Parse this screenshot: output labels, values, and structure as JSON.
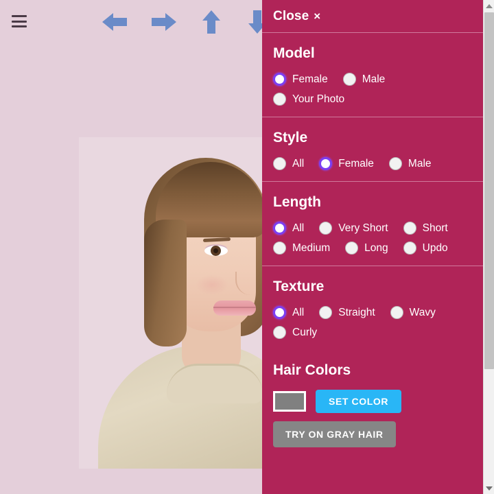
{
  "toolbar": {
    "menu_icon": "hamburger-menu-icon",
    "arrows": [
      {
        "name": "previous-arrow",
        "icon": "arrow-left-icon",
        "color": "#6a8bc8"
      },
      {
        "name": "next-arrow",
        "icon": "arrow-right-icon",
        "color": "#6a8bc8"
      },
      {
        "name": "up-arrow",
        "icon": "arrow-up-icon",
        "color": "#6a8bc8"
      },
      {
        "name": "down-arrow",
        "icon": "arrow-down-icon",
        "color": "#6a8bc8"
      }
    ]
  },
  "photo": {
    "alt": "model-preview-photo",
    "background_color": "#e4cfda"
  },
  "panel": {
    "background_color": "#b02458",
    "close_label": "Close",
    "close_x": "×",
    "sections": [
      {
        "title": "Model",
        "rows": [
          [
            {
              "label": "Female",
              "checked": true
            },
            {
              "label": "Male",
              "checked": false
            }
          ],
          [
            {
              "label": "Your Photo",
              "checked": false
            }
          ]
        ]
      },
      {
        "title": "Style",
        "rows": [
          [
            {
              "label": "All",
              "checked": false
            },
            {
              "label": "Female",
              "checked": true
            },
            {
              "label": "Male",
              "checked": false
            }
          ]
        ]
      },
      {
        "title": "Length",
        "rows": [
          [
            {
              "label": "All",
              "checked": true
            },
            {
              "label": "Very Short",
              "checked": false
            },
            {
              "label": "Short",
              "checked": false
            }
          ],
          [
            {
              "label": "Medium",
              "checked": false
            },
            {
              "label": "Long",
              "checked": false
            },
            {
              "label": "Updo",
              "checked": false
            }
          ]
        ]
      },
      {
        "title": "Texture",
        "rows": [
          [
            {
              "label": "All",
              "checked": true
            },
            {
              "label": "Straight",
              "checked": false
            },
            {
              "label": "Wavy",
              "checked": false
            }
          ],
          [
            {
              "label": "Curly",
              "checked": false
            }
          ]
        ]
      }
    ],
    "hair_colors": {
      "title": "Hair Colors",
      "swatch_color": "#808080",
      "set_color_label": "SET COLOR",
      "set_color_bg": "#29b6f6",
      "try_gray_label": "TRY ON GRAY HAIR",
      "try_gray_bg": "#868686"
    },
    "radio_checked_color": "#7b3ff2"
  },
  "scrollbar": {
    "up_icon": "scroll-up-arrow-icon",
    "down_icon": "scroll-down-arrow-icon",
    "thumb_color": "#c3c3c3",
    "track_color": "#f1f1f1"
  }
}
